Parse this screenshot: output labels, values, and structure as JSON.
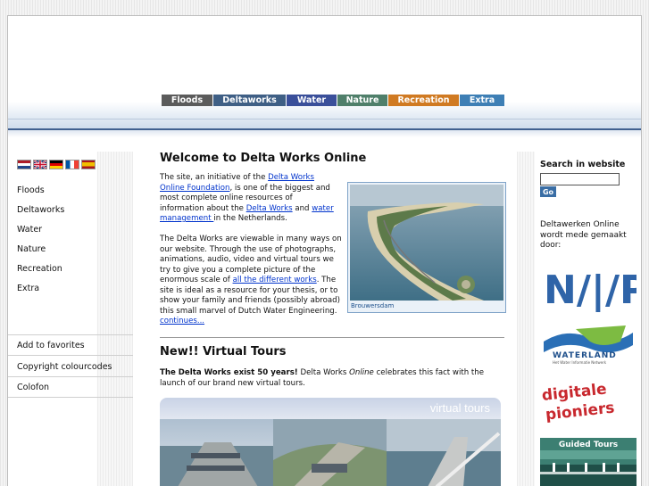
{
  "nav": {
    "tabs": [
      {
        "label": "Floods",
        "color": "#5b5b5b",
        "width": 58
      },
      {
        "label": "Deltaworks",
        "color": "#3f5f85",
        "width": 82
      },
      {
        "label": "Water",
        "color": "#3a4f9a",
        "width": 57
      },
      {
        "label": "Nature",
        "color": "#4f7f6a",
        "width": 57
      },
      {
        "label": "Recreation",
        "color": "#d07a22",
        "width": 80
      },
      {
        "label": "Extra",
        "color": "#3e7fb5",
        "width": 51
      }
    ]
  },
  "sidebar": {
    "flags": [
      "nl-flag-icon",
      "uk-flag-icon",
      "de-flag-icon",
      "fr-flag-icon",
      "es-flag-icon"
    ],
    "items": [
      "Floods",
      "Deltaworks",
      "Water",
      "Nature",
      "Recreation",
      "Extra"
    ],
    "extra_items": [
      "Add to favorites",
      "Copyright colourcodes",
      "Colofon"
    ]
  },
  "main": {
    "title": "Welcome to Delta Works Online",
    "intro": {
      "t1": "The site, an initiative of the ",
      "link1": "Delta Works Online Foundation",
      "t2": ", is one of the biggest and most complete online resources of information about the ",
      "link2": "Delta Works",
      "t3": " and ",
      "link3": "water management ",
      "t4": "in the Netherlands."
    },
    "body": {
      "t1": "The Delta Works are viewable in many ways on our website. Through the use of photographs, animations, audio, video and virtual tours we try to give you a complete picture of the enormous scale of ",
      "link1": "all the different works",
      "t2": ". The site is ideal as a resource for your thesis, or to show your family and friends (possibly abroad) this small marvel of Dutch Water Engineering.  ",
      "link2": "continues..."
    },
    "photo_caption": "Brouwersdam",
    "section_title": "New!! Virtual Tours",
    "news": {
      "bold": "The Delta Works exist 50 years!",
      "t1": " Delta Works ",
      "italic": "Online",
      "t2": " celebrates this fact with the launch of our brand new virtual tours."
    },
    "banner_label": "virtual tours"
  },
  "right": {
    "search_label": "Search in website",
    "search_value": "",
    "go_label": "Go",
    "partner_text": "Deltawerken Online wordt mede gemaakt door:",
    "logos": {
      "nwp": "N/|/P",
      "waterland": "WATERLAND",
      "waterland_sub": "Het Water Informatie Netwerk",
      "digitale1": "digitale",
      "digitale2": "pioniers",
      "guided": "Guided Tours"
    }
  }
}
